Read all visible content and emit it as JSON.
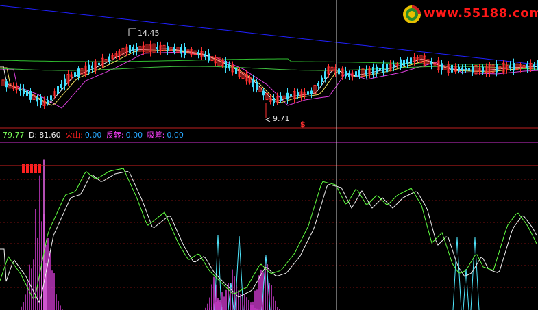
{
  "watermark": {
    "text": "www.55188.com"
  },
  "price_panel": {
    "high_label": "14.45",
    "low_label": "9.71",
    "signal_symbol": "$",
    "colors": {
      "up": "#ff3030",
      "down": "#40e0ff",
      "ma_blue": "#2020ff",
      "ma_magenta": "#e040e0",
      "ma_green": "#30c030",
      "ma_yellow": "#f0e060",
      "ma_white": "#e8e8e8"
    }
  },
  "indicator_bar": {
    "k_value": "79.77",
    "d_label": "D:",
    "d_value": "81.60",
    "volcano_label": "火山:",
    "volcano_value": "0.00",
    "reversal_label": "反转:",
    "reversal_value": "0.00",
    "accumulate_label": "吸筹:",
    "accumulate_value": "0.00"
  },
  "chart_data": {
    "type": "line",
    "panels": [
      {
        "name": "price",
        "y_extremes": {
          "high": 14.45,
          "low": 9.71
        }
      },
      {
        "name": "indicator",
        "series": [
          "K",
          "D",
          "火山",
          "反转",
          "吸筹"
        ]
      }
    ]
  }
}
